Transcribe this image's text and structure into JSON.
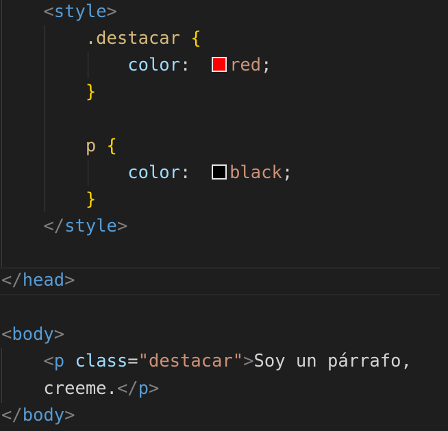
{
  "colors": {
    "red_swatch": "#ff0000",
    "black_swatch": "#000000"
  },
  "code": {
    "open_bracket": "<",
    "close_bracket": ">",
    "close_slash": "</",
    "style_tag": "style",
    "selector_destacar": ".destacar",
    "selector_p": "p",
    "brace_open": "{",
    "brace_close": "}",
    "prop_color": "color",
    "colon": ":",
    "value_red": "red",
    "value_black": "black",
    "semicolon": ";",
    "head_tag": "head",
    "body_tag": "body",
    "p_tag": "p",
    "attr_class": "class",
    "equals": "=",
    "attr_value": "\"destacar\"",
    "paragraph_text_1": "Soy un párrafo,",
    "paragraph_text_2": "creeme."
  }
}
